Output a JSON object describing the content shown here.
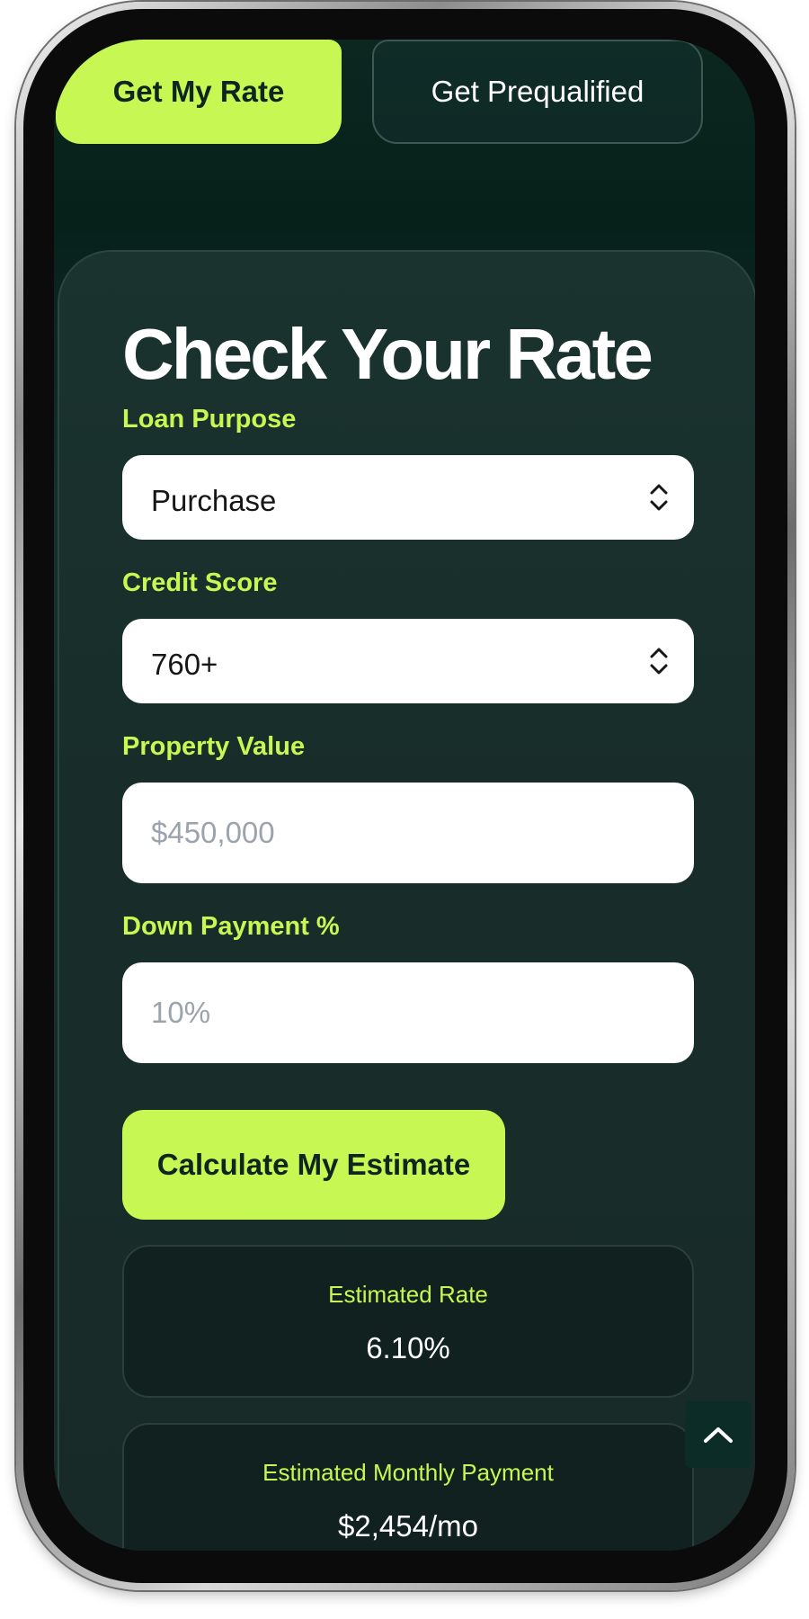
{
  "tabs": {
    "primary_label": "Get My Rate",
    "secondary_label": "Get Prequalified"
  },
  "form": {
    "title": "Check Your Rate",
    "loan_purpose": {
      "label": "Loan Purpose",
      "value": "Purchase"
    },
    "credit_score": {
      "label": "Credit Score",
      "value": "760+"
    },
    "property_value": {
      "label": "Property Value",
      "placeholder": "$450,000"
    },
    "down_payment": {
      "label": "Down Payment %",
      "placeholder": "10%"
    },
    "submit_label": "Calculate My Estimate"
  },
  "results": {
    "rate": {
      "label": "Estimated Rate",
      "value": "6.10%"
    },
    "monthly_payment": {
      "label": "Estimated Monthly Payment",
      "value": "$2,454/mo"
    }
  },
  "colors": {
    "accent": "#c6f752",
    "background": "#172d29",
    "card": "#1a332f",
    "result_card": "#11211f"
  },
  "icons": {
    "select_chevron": "chevron-up-down-icon",
    "scroll_top": "chevron-up-icon"
  }
}
